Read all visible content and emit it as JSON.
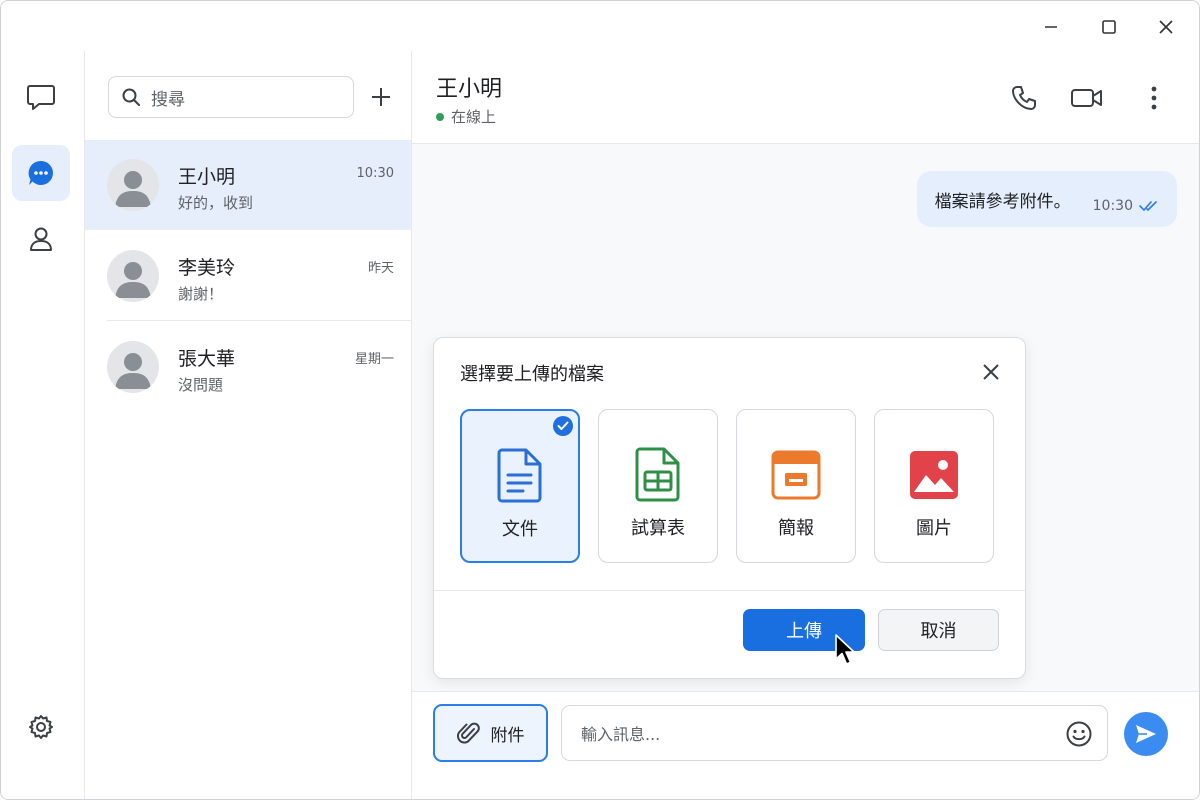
{
  "window": {
    "controls": [
      "minimize-icon",
      "maximize-icon",
      "close-icon"
    ]
  },
  "rail": {
    "items": [
      {
        "icon": "chat-bubble-icon",
        "active": false
      },
      {
        "icon": "chat-filled-icon",
        "active": true
      },
      {
        "icon": "person-icon",
        "active": false
      }
    ],
    "bottom_icon": "gear-icon"
  },
  "search": {
    "placeholder": "搜尋"
  },
  "conversations": [
    {
      "name": "王小明",
      "preview": "好的，收到",
      "time": "10:30",
      "active": true
    },
    {
      "name": "李美玲",
      "preview": "謝謝！",
      "time": "昨天",
      "active": false
    },
    {
      "name": "張大華",
      "preview": "沒問題",
      "time": "星期一",
      "active": false
    }
  ],
  "chat": {
    "contact_name": "王小明",
    "status": "在線上",
    "status_color": "#2e9e5b",
    "messages": [
      {
        "text": "檔案請參考附件。",
        "time": "10:30",
        "outgoing": true,
        "read": true
      }
    ]
  },
  "dialog": {
    "title": "選擇要上傳的檔案",
    "options": [
      {
        "label": "文件",
        "icon": "document-icon",
        "color": "#2b6fd6",
        "selected": true
      },
      {
        "label": "試算表",
        "icon": "spreadsheet-icon",
        "color": "#2f8f46",
        "selected": false
      },
      {
        "label": "簡報",
        "icon": "presentation-icon",
        "color": "#ec7a2c",
        "selected": false
      },
      {
        "label": "圖片",
        "icon": "image-icon",
        "color": "#e2434b",
        "selected": false
      }
    ],
    "upload_label": "上傳",
    "cancel_label": "取消"
  },
  "composer": {
    "attach_label": "附件",
    "input_placeholder": "輸入訊息..."
  },
  "colors": {
    "accent": "#1a6fe0",
    "selected_bg": "#e6eefb"
  }
}
